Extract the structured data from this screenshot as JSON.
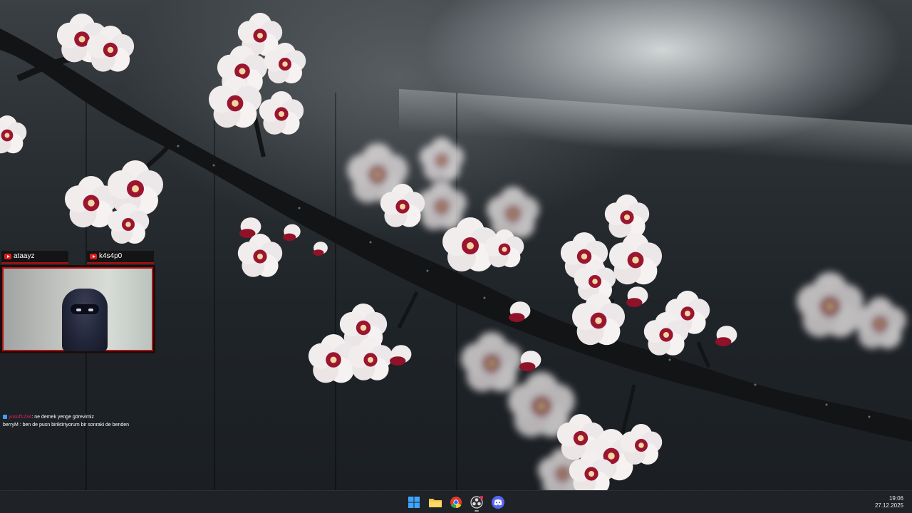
{
  "overlay": {
    "cam_tags": [
      {
        "name": "ataayz",
        "icon": "youtube-icon"
      },
      {
        "name": "k4s4p0",
        "icon": "youtube-icon"
      }
    ]
  },
  "chat": {
    "messages": [
      {
        "user": "yusuf1234",
        "text": ": ne demek yenge görevimiz"
      },
      {
        "user": "berryM",
        "text": " : ben de pusn biriktiriyorum bir sonraki de benden"
      }
    ]
  },
  "taskbar": {
    "apps": [
      {
        "name": "start",
        "icon": "windows-start-icon"
      },
      {
        "name": "file-explorer",
        "icon": "folder-icon"
      },
      {
        "name": "chrome",
        "icon": "chrome-icon"
      },
      {
        "name": "obs",
        "icon": "obs-icon"
      },
      {
        "name": "discord",
        "icon": "discord-icon"
      }
    ],
    "clock": {
      "time": "19:06",
      "date": "27.12.2025"
    }
  },
  "colors": {
    "accent": "#b31313",
    "blossom": "#f3eeee",
    "blossom_center": "#9b1530",
    "branch": "#121416"
  }
}
